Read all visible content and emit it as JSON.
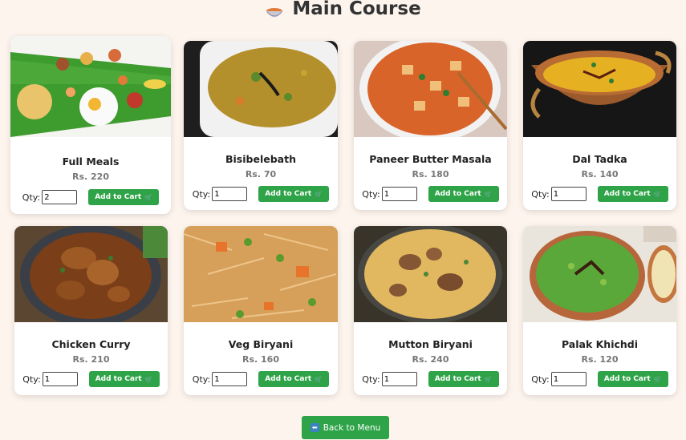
{
  "page": {
    "title": "Main Course",
    "title_icon": "food-bowl-icon"
  },
  "items": [
    {
      "name": "Full Meals",
      "price": "Rs. 220",
      "qty_label": "Qty:",
      "qty": "2",
      "button": "Add to Cart"
    },
    {
      "name": "Bisibelebath",
      "price": "Rs. 70",
      "qty_label": "Qty:",
      "qty": "1",
      "button": "Add to Cart"
    },
    {
      "name": "Paneer Butter Masala",
      "price": "Rs. 180",
      "qty_label": "Qty:",
      "qty": "1",
      "button": "Add to Cart"
    },
    {
      "name": "Dal Tadka",
      "price": "Rs. 140",
      "qty_label": "Qty:",
      "qty": "1",
      "button": "Add to Cart"
    },
    {
      "name": "Chicken Curry",
      "price": "Rs. 210",
      "qty_label": "Qty:",
      "qty": "1",
      "button": "Add to Cart"
    },
    {
      "name": "Veg Biryani",
      "price": "Rs. 160",
      "qty_label": "Qty:",
      "qty": "1",
      "button": "Add to Cart"
    },
    {
      "name": "Mutton Biryani",
      "price": "Rs. 240",
      "qty_label": "Qty:",
      "qty": "1",
      "button": "Add to Cart"
    },
    {
      "name": "Palak Khichdi",
      "price": "Rs. 120",
      "qty_label": "Qty:",
      "qty": "1",
      "button": "Add to Cart"
    }
  ],
  "back_button": {
    "label": "Back to Menu",
    "icon": "back-arrow-icon"
  },
  "colors": {
    "accent": "#2ea347",
    "background": "#fdf4ee"
  }
}
